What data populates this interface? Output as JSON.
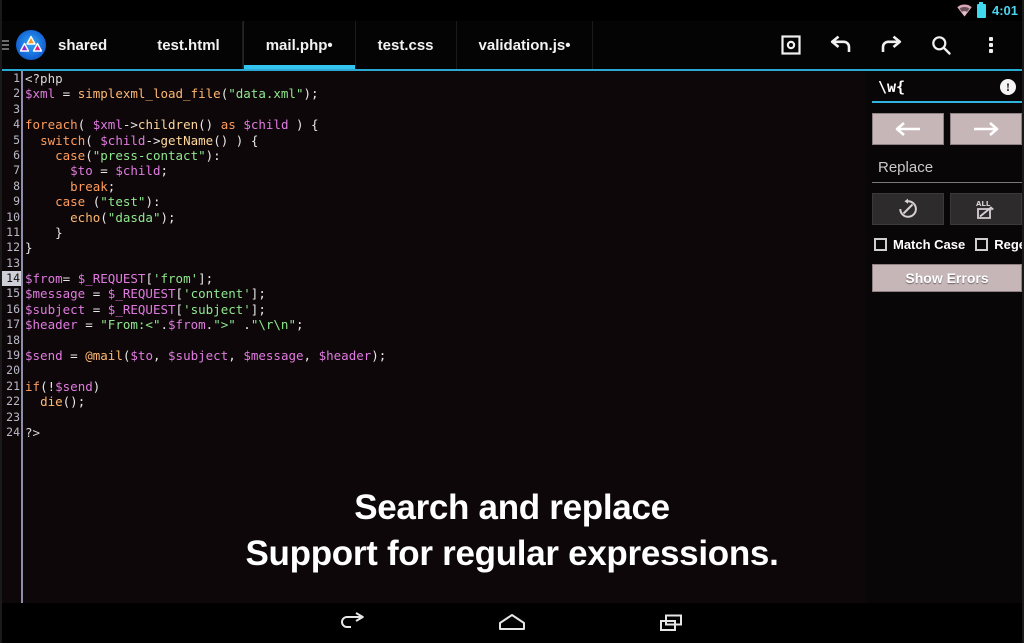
{
  "status_bar": {
    "clock": "4:01",
    "wifi_icon": "wifi-icon",
    "battery_icon": "battery-icon",
    "accent_color": "#4bd4ec"
  },
  "top_bar": {
    "drawer_icon": "hamburger-menu-icon",
    "app_logo": "app-logo-icon",
    "tabs": [
      {
        "label": "shared",
        "active": false,
        "modified": false
      },
      {
        "label": "test.html",
        "active": false,
        "modified": false
      },
      {
        "label": "mail.php•",
        "active": true,
        "modified": true
      },
      {
        "label": "test.css",
        "active": false,
        "modified": false
      },
      {
        "label": "validation.js•",
        "active": false,
        "modified": true
      }
    ],
    "active_tab_underline_color": "#33c5ef",
    "toolbar": [
      {
        "name": "save-icon",
        "label": "Save"
      },
      {
        "name": "undo-icon",
        "label": "Undo"
      },
      {
        "name": "redo-icon",
        "label": "Redo"
      },
      {
        "name": "search-icon",
        "label": "Search"
      },
      {
        "name": "overflow-menu-icon",
        "label": "More options"
      }
    ]
  },
  "editor": {
    "language": "php",
    "filename": "mail.php",
    "current_line": 14,
    "background": "#0d0709",
    "gutter_color": "#b9b9c8",
    "lines": [
      {
        "n": 1,
        "tokens": [
          {
            "t": "<?php",
            "c": "t-def"
          }
        ]
      },
      {
        "n": 2,
        "tokens": [
          {
            "t": "$xml",
            "c": "t-var"
          },
          {
            "t": " = ",
            "c": "t-op"
          },
          {
            "t": "simplexml_load_file",
            "c": "t-kw2"
          },
          {
            "t": "(",
            "c": "t-punc"
          },
          {
            "t": "\"data.xml\"",
            "c": "t-str"
          },
          {
            "t": ");",
            "c": "t-punc"
          }
        ]
      },
      {
        "n": 3,
        "tokens": [
          {
            "t": "",
            "c": "t-def"
          }
        ]
      },
      {
        "n": 4,
        "tokens": [
          {
            "t": "foreach",
            "c": "t-kw"
          },
          {
            "t": "( ",
            "c": "t-punc"
          },
          {
            "t": "$xml",
            "c": "t-var"
          },
          {
            "t": "->",
            "c": "t-op"
          },
          {
            "t": "children",
            "c": "t-prop"
          },
          {
            "t": "() ",
            "c": "t-punc"
          },
          {
            "t": "as",
            "c": "t-kw"
          },
          {
            "t": " ",
            "c": "t-op"
          },
          {
            "t": "$child",
            "c": "t-var"
          },
          {
            "t": " ) {",
            "c": "t-punc"
          }
        ]
      },
      {
        "n": 5,
        "tokens": [
          {
            "t": "  ",
            "c": "t-op"
          },
          {
            "t": "switch",
            "c": "t-kw"
          },
          {
            "t": "( ",
            "c": "t-punc"
          },
          {
            "t": "$child",
            "c": "t-var"
          },
          {
            "t": "->",
            "c": "t-op"
          },
          {
            "t": "getName",
            "c": "t-prop"
          },
          {
            "t": "() ) {",
            "c": "t-punc"
          }
        ]
      },
      {
        "n": 6,
        "tokens": [
          {
            "t": "    ",
            "c": "t-op"
          },
          {
            "t": "case",
            "c": "t-kw"
          },
          {
            "t": "(",
            "c": "t-punc"
          },
          {
            "t": "\"press-contact\"",
            "c": "t-str"
          },
          {
            "t": "):",
            "c": "t-punc"
          }
        ]
      },
      {
        "n": 7,
        "tokens": [
          {
            "t": "      ",
            "c": "t-op"
          },
          {
            "t": "$to",
            "c": "t-var"
          },
          {
            "t": " = ",
            "c": "t-op"
          },
          {
            "t": "$child",
            "c": "t-var"
          },
          {
            "t": ";",
            "c": "t-punc"
          }
        ]
      },
      {
        "n": 8,
        "tokens": [
          {
            "t": "      ",
            "c": "t-op"
          },
          {
            "t": "break",
            "c": "t-kw"
          },
          {
            "t": ";",
            "c": "t-punc"
          }
        ]
      },
      {
        "n": 9,
        "tokens": [
          {
            "t": "    ",
            "c": "t-op"
          },
          {
            "t": "case",
            "c": "t-kw"
          },
          {
            "t": " (",
            "c": "t-punc"
          },
          {
            "t": "\"test\"",
            "c": "t-str"
          },
          {
            "t": "):",
            "c": "t-punc"
          }
        ]
      },
      {
        "n": 10,
        "tokens": [
          {
            "t": "      ",
            "c": "t-op"
          },
          {
            "t": "echo",
            "c": "t-kw2"
          },
          {
            "t": "(",
            "c": "t-punc"
          },
          {
            "t": "\"dasda\"",
            "c": "t-str"
          },
          {
            "t": ");",
            "c": "t-punc"
          }
        ]
      },
      {
        "n": 11,
        "tokens": [
          {
            "t": "    }",
            "c": "t-punc"
          }
        ]
      },
      {
        "n": 12,
        "tokens": [
          {
            "t": "}",
            "c": "t-punc"
          }
        ]
      },
      {
        "n": 13,
        "tokens": [
          {
            "t": "",
            "c": "t-def"
          }
        ]
      },
      {
        "n": 14,
        "tokens": [
          {
            "t": "$from",
            "c": "t-var"
          },
          {
            "t": "= ",
            "c": "t-op"
          },
          {
            "t": "$_REQUEST",
            "c": "t-var"
          },
          {
            "t": "[",
            "c": "t-punc"
          },
          {
            "t": "'from'",
            "c": "t-str"
          },
          {
            "t": "];",
            "c": "t-punc"
          }
        ],
        "current": true
      },
      {
        "n": 15,
        "tokens": [
          {
            "t": "$message",
            "c": "t-var"
          },
          {
            "t": " = ",
            "c": "t-op"
          },
          {
            "t": "$_REQUEST",
            "c": "t-var"
          },
          {
            "t": "[",
            "c": "t-punc"
          },
          {
            "t": "'content'",
            "c": "t-str"
          },
          {
            "t": "];",
            "c": "t-punc"
          }
        ]
      },
      {
        "n": 16,
        "tokens": [
          {
            "t": "$subject",
            "c": "t-var"
          },
          {
            "t": " = ",
            "c": "t-op"
          },
          {
            "t": "$_REQUEST",
            "c": "t-var"
          },
          {
            "t": "[",
            "c": "t-punc"
          },
          {
            "t": "'subject'",
            "c": "t-str"
          },
          {
            "t": "];",
            "c": "t-punc"
          }
        ]
      },
      {
        "n": 17,
        "tokens": [
          {
            "t": "$header",
            "c": "t-var"
          },
          {
            "t": " = ",
            "c": "t-op"
          },
          {
            "t": "\"From:<\"",
            "c": "t-str"
          },
          {
            "t": ".",
            "c": "t-op"
          },
          {
            "t": "$from",
            "c": "t-var"
          },
          {
            "t": ".",
            "c": "t-op"
          },
          {
            "t": "\">\"",
            "c": "t-str"
          },
          {
            "t": " .",
            "c": "t-op"
          },
          {
            "t": "\"\\r\\n\"",
            "c": "t-str"
          },
          {
            "t": ";",
            "c": "t-punc"
          }
        ]
      },
      {
        "n": 18,
        "tokens": [
          {
            "t": "",
            "c": "t-def"
          }
        ]
      },
      {
        "n": 19,
        "tokens": [
          {
            "t": "$send",
            "c": "t-var"
          },
          {
            "t": " = ",
            "c": "t-op"
          },
          {
            "t": "@mail",
            "c": "t-kw2"
          },
          {
            "t": "(",
            "c": "t-punc"
          },
          {
            "t": "$to",
            "c": "t-var"
          },
          {
            "t": ", ",
            "c": "t-punc"
          },
          {
            "t": "$subject",
            "c": "t-var"
          },
          {
            "t": ", ",
            "c": "t-punc"
          },
          {
            "t": "$message",
            "c": "t-var"
          },
          {
            "t": ", ",
            "c": "t-punc"
          },
          {
            "t": "$header",
            "c": "t-var"
          },
          {
            "t": ");",
            "c": "t-punc"
          }
        ]
      },
      {
        "n": 20,
        "tokens": [
          {
            "t": "",
            "c": "t-def"
          }
        ]
      },
      {
        "n": 21,
        "tokens": [
          {
            "t": "if",
            "c": "t-kw"
          },
          {
            "t": "(!",
            "c": "t-punc"
          },
          {
            "t": "$send",
            "c": "t-var"
          },
          {
            "t": ")",
            "c": "t-punc"
          }
        ]
      },
      {
        "n": 22,
        "tokens": [
          {
            "t": "  ",
            "c": "t-op"
          },
          {
            "t": "die",
            "c": "t-kw2"
          },
          {
            "t": "();",
            "c": "t-punc"
          }
        ]
      },
      {
        "n": 23,
        "tokens": [
          {
            "t": "",
            "c": "t-def"
          }
        ]
      },
      {
        "n": 24,
        "tokens": [
          {
            "t": "?>",
            "c": "t-def"
          }
        ]
      }
    ]
  },
  "search_panel": {
    "search_value": "\\w{",
    "search_error_badge": "error-icon",
    "prev_button_icon": "arrow-left-icon",
    "next_button_icon": "arrow-right-icon",
    "replace_placeholder": "Replace",
    "replace_value": "",
    "replace_one_icon": "replace-icon",
    "replace_all_icon": "replace-all-icon",
    "match_case_label": "Match Case",
    "match_case_checked": false,
    "regex_label": "Regex",
    "regex_checked": false,
    "show_errors_label": "Show Errors"
  },
  "caption": {
    "line1": "Search and replace",
    "line2": "Support for regular expressions."
  },
  "nav_bar": {
    "back_icon": "back-icon",
    "home_icon": "home-icon",
    "recents_icon": "recents-icon"
  }
}
